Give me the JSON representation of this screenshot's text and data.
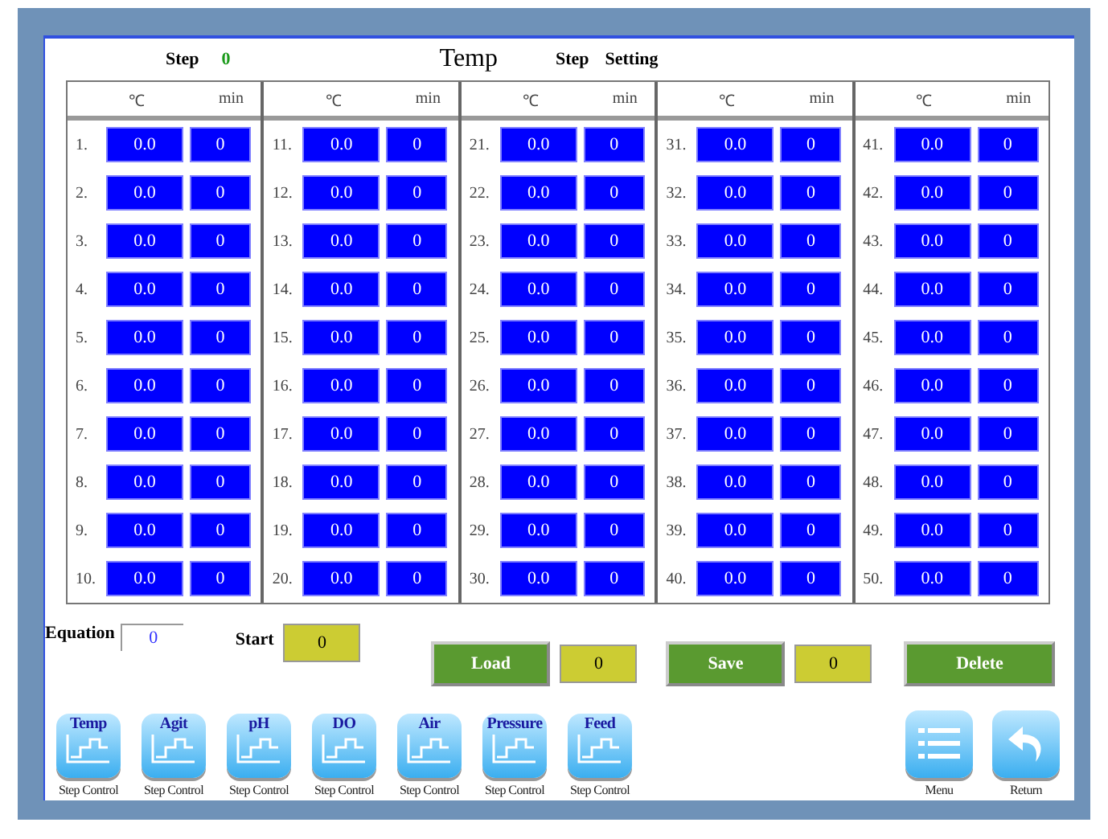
{
  "header": {
    "step_label": "Step",
    "step_value": "0",
    "title": "Temp",
    "setting_label": "Step",
    "setting_value": "Setting"
  },
  "columns": [
    {
      "temp_header": "℃",
      "time_header": "min",
      "steps": [
        {
          "num": "1.",
          "temp": "0.0",
          "time": "0"
        },
        {
          "num": "2.",
          "temp": "0.0",
          "time": "0"
        },
        {
          "num": "3.",
          "temp": "0.0",
          "time": "0"
        },
        {
          "num": "4.",
          "temp": "0.0",
          "time": "0"
        },
        {
          "num": "5.",
          "temp": "0.0",
          "time": "0"
        },
        {
          "num": "6.",
          "temp": "0.0",
          "time": "0"
        },
        {
          "num": "7.",
          "temp": "0.0",
          "time": "0"
        },
        {
          "num": "8.",
          "temp": "0.0",
          "time": "0"
        },
        {
          "num": "9.",
          "temp": "0.0",
          "time": "0"
        },
        {
          "num": "10.",
          "temp": "0.0",
          "time": "0"
        }
      ]
    },
    {
      "temp_header": "℃",
      "time_header": "min",
      "steps": [
        {
          "num": "11.",
          "temp": "0.0",
          "time": "0"
        },
        {
          "num": "12.",
          "temp": "0.0",
          "time": "0"
        },
        {
          "num": "13.",
          "temp": "0.0",
          "time": "0"
        },
        {
          "num": "14.",
          "temp": "0.0",
          "time": "0"
        },
        {
          "num": "15.",
          "temp": "0.0",
          "time": "0"
        },
        {
          "num": "16.",
          "temp": "0.0",
          "time": "0"
        },
        {
          "num": "17.",
          "temp": "0.0",
          "time": "0"
        },
        {
          "num": "18.",
          "temp": "0.0",
          "time": "0"
        },
        {
          "num": "19.",
          "temp": "0.0",
          "time": "0"
        },
        {
          "num": "20.",
          "temp": "0.0",
          "time": "0"
        }
      ]
    },
    {
      "temp_header": "℃",
      "time_header": "min",
      "steps": [
        {
          "num": "21.",
          "temp": "0.0",
          "time": "0"
        },
        {
          "num": "22.",
          "temp": "0.0",
          "time": "0"
        },
        {
          "num": "23.",
          "temp": "0.0",
          "time": "0"
        },
        {
          "num": "24.",
          "temp": "0.0",
          "time": "0"
        },
        {
          "num": "25.",
          "temp": "0.0",
          "time": "0"
        },
        {
          "num": "26.",
          "temp": "0.0",
          "time": "0"
        },
        {
          "num": "27.",
          "temp": "0.0",
          "time": "0"
        },
        {
          "num": "28.",
          "temp": "0.0",
          "time": "0"
        },
        {
          "num": "29.",
          "temp": "0.0",
          "time": "0"
        },
        {
          "num": "30.",
          "temp": "0.0",
          "time": "0"
        }
      ]
    },
    {
      "temp_header": "℃",
      "time_header": "min",
      "steps": [
        {
          "num": "31.",
          "temp": "0.0",
          "time": "0"
        },
        {
          "num": "32.",
          "temp": "0.0",
          "time": "0"
        },
        {
          "num": "33.",
          "temp": "0.0",
          "time": "0"
        },
        {
          "num": "34.",
          "temp": "0.0",
          "time": "0"
        },
        {
          "num": "35.",
          "temp": "0.0",
          "time": "0"
        },
        {
          "num": "36.",
          "temp": "0.0",
          "time": "0"
        },
        {
          "num": "37.",
          "temp": "0.0",
          "time": "0"
        },
        {
          "num": "38.",
          "temp": "0.0",
          "time": "0"
        },
        {
          "num": "39.",
          "temp": "0.0",
          "time": "0"
        },
        {
          "num": "40.",
          "temp": "0.0",
          "time": "0"
        }
      ]
    },
    {
      "temp_header": "℃",
      "time_header": "min",
      "steps": [
        {
          "num": "41.",
          "temp": "0.0",
          "time": "0"
        },
        {
          "num": "42.",
          "temp": "0.0",
          "time": "0"
        },
        {
          "num": "43.",
          "temp": "0.0",
          "time": "0"
        },
        {
          "num": "44.",
          "temp": "0.0",
          "time": "0"
        },
        {
          "num": "45.",
          "temp": "0.0",
          "time": "0"
        },
        {
          "num": "46.",
          "temp": "0.0",
          "time": "0"
        },
        {
          "num": "47.",
          "temp": "0.0",
          "time": "0"
        },
        {
          "num": "48.",
          "temp": "0.0",
          "time": "0"
        },
        {
          "num": "49.",
          "temp": "0.0",
          "time": "0"
        },
        {
          "num": "50.",
          "temp": "0.0",
          "time": "0"
        }
      ]
    }
  ],
  "equation": {
    "label": "Equation",
    "value": "0"
  },
  "start": {
    "label": "Start",
    "value": "0"
  },
  "load": {
    "label": "Load",
    "value": "0"
  },
  "save": {
    "label": "Save",
    "value": "0"
  },
  "delete_button": "Delete",
  "step_controls": [
    {
      "label": "Temp",
      "caption": "Step Control"
    },
    {
      "label": "Agit",
      "caption": "Step Control"
    },
    {
      "label": "pH",
      "caption": "Step Control"
    },
    {
      "label": "DO",
      "caption": "Step Control"
    },
    {
      "label": "Air",
      "caption": "Step Control"
    },
    {
      "label": "Pressure",
      "caption": "Step Control"
    },
    {
      "label": "Feed",
      "caption": "Step Control"
    }
  ],
  "nav": [
    {
      "kind": "menu",
      "caption": "Menu"
    },
    {
      "kind": "return",
      "caption": "Return"
    }
  ]
}
